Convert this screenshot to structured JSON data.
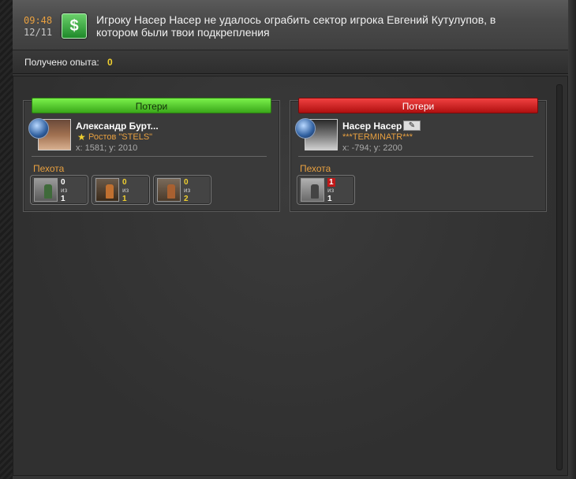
{
  "header": {
    "time": "09:48",
    "date": "12/11",
    "icon": "money-icon",
    "message": "Игроку Насер Насер не удалось ограбить сектор игрока Евгений Кутулупов, в котором были твои подкрепления"
  },
  "experience": {
    "label": "Получено опыта:",
    "value": "0"
  },
  "left_panel": {
    "loss_label": "Потери",
    "name": "Александр Бурт...",
    "clan": "Ростов \"STELS\"",
    "coords": "x: 1581; y: 2010",
    "category": "Пехота",
    "units": [
      {
        "lost": "0",
        "of": "из",
        "total": "1",
        "highlight": false
      },
      {
        "lost": "0",
        "of": "из",
        "total": "1",
        "highlight": true
      },
      {
        "lost": "0",
        "of": "из",
        "total": "2",
        "highlight": true
      }
    ]
  },
  "right_panel": {
    "loss_label": "Потери",
    "name": "Насер Насер",
    "clan": "***TERMINATR***",
    "coords": "x: -794; y: 2200",
    "category": "Пехота",
    "units": [
      {
        "lost": "1",
        "of": "из",
        "total": "1",
        "highlight": false
      }
    ]
  },
  "colors": {
    "accent": "#e8a040",
    "positive": "#3aa81a",
    "negative": "#b01010",
    "xp": "#f0d030"
  }
}
